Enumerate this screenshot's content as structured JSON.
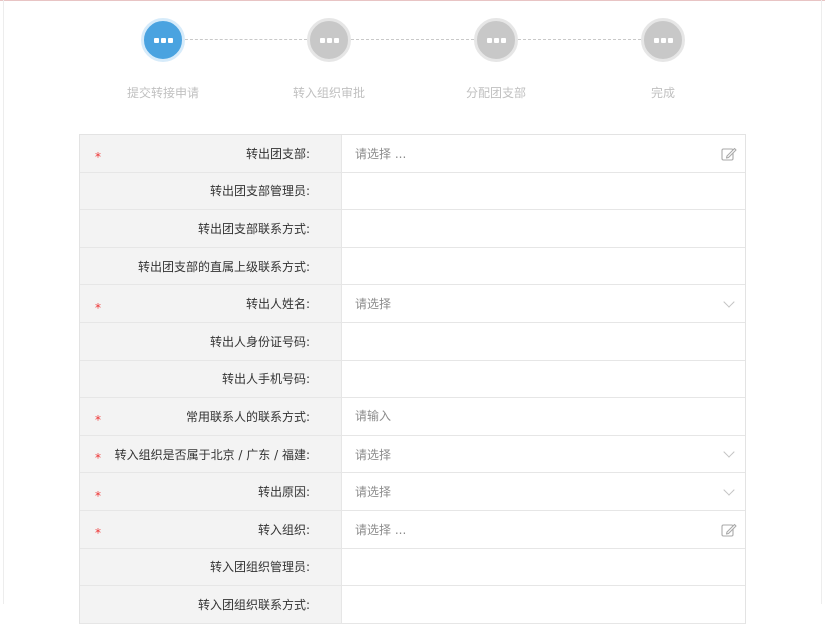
{
  "stepper": {
    "steps": [
      {
        "label": "提交转接申请",
        "state": "active"
      },
      {
        "label": "转入组织审批",
        "state": "pending"
      },
      {
        "label": "分配团支部",
        "state": "pending"
      },
      {
        "label": "完成",
        "state": "pending"
      }
    ],
    "icon": "ellipsis-icon"
  },
  "form": {
    "required_mark": "*",
    "rows": [
      {
        "label": "转出团支部:",
        "required": true,
        "control": "picker",
        "placeholder": "请选择 ..."
      },
      {
        "label": "转出团支部管理员:",
        "required": false,
        "control": "static",
        "value": ""
      },
      {
        "label": "转出团支部联系方式:",
        "required": false,
        "control": "static",
        "value": ""
      },
      {
        "label": "转出团支部的直属上级联系方式:",
        "required": false,
        "control": "static",
        "value": ""
      },
      {
        "label": "转出人姓名:",
        "required": true,
        "control": "select",
        "placeholder": "请选择"
      },
      {
        "label": "转出人身份证号码:",
        "required": false,
        "control": "static",
        "value": ""
      },
      {
        "label": "转出人手机号码:",
        "required": false,
        "control": "static",
        "value": ""
      },
      {
        "label": "常用联系人的联系方式:",
        "required": true,
        "control": "input",
        "placeholder": "请输入"
      },
      {
        "label": "转入组织是否属于北京 / 广东 / 福建:",
        "required": true,
        "control": "select",
        "placeholder": "请选择"
      },
      {
        "label": "转出原因:",
        "required": true,
        "control": "select",
        "placeholder": "请选择"
      },
      {
        "label": "转入组织:",
        "required": true,
        "control": "picker",
        "placeholder": "请选择 ..."
      },
      {
        "label": "转入团组织管理员:",
        "required": false,
        "control": "static",
        "value": ""
      },
      {
        "label": "转入团组织联系方式:",
        "required": false,
        "control": "static",
        "value": ""
      }
    ]
  },
  "colors": {
    "accent": "#4aa3e0",
    "pending": "#c8c8c8",
    "required": "#ee3333",
    "label_bg": "#f3f3f3"
  }
}
